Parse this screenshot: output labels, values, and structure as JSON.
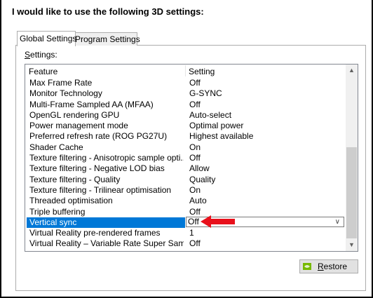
{
  "dialog": {
    "heading": "I would like to use the following 3D settings:"
  },
  "tabs": [
    {
      "label": "Global Settings",
      "active": true
    },
    {
      "label": "Program Settings",
      "active": false
    }
  ],
  "settings_label": "Settings:",
  "settings_label_parts": {
    "underlined": "S",
    "rest": "ettings:"
  },
  "table": {
    "columns": [
      "Feature",
      "Setting"
    ],
    "rows": [
      {
        "feature": "Max Frame Rate",
        "setting": "Off"
      },
      {
        "feature": "Monitor Technology",
        "setting": "G-SYNC"
      },
      {
        "feature": "Multi-Frame Sampled AA (MFAA)",
        "setting": "Off"
      },
      {
        "feature": "OpenGL rendering GPU",
        "setting": "Auto-select"
      },
      {
        "feature": "Power management mode",
        "setting": "Optimal power"
      },
      {
        "feature": "Preferred refresh rate (ROG PG27U)",
        "setting": "Highest available"
      },
      {
        "feature": "Shader Cache",
        "setting": "On"
      },
      {
        "feature": "Texture filtering - Anisotropic sample opti...",
        "setting": "Off"
      },
      {
        "feature": "Texture filtering - Negative LOD bias",
        "setting": "Allow"
      },
      {
        "feature": "Texture filtering - Quality",
        "setting": "Quality"
      },
      {
        "feature": "Texture filtering - Trilinear optimisation",
        "setting": "On"
      },
      {
        "feature": "Threaded optimisation",
        "setting": "Auto"
      },
      {
        "feature": "Triple buffering",
        "setting": "Off"
      },
      {
        "feature": "Vertical sync",
        "setting": "Off",
        "selected": true
      },
      {
        "feature": "Virtual Reality pre-rendered frames",
        "setting": "1"
      },
      {
        "feature": "Virtual Reality – Variable Rate Super Sampli...",
        "setting": "Off"
      }
    ]
  },
  "restore_button": {
    "label_underlined": "R",
    "label_rest": "estore"
  },
  "colors": {
    "selection": "#0078d7",
    "annotation_arrow": "#e8101b",
    "nvidia_green": "#76b900"
  },
  "icons": {
    "scroll_up": "chevron-up-icon",
    "scroll_down": "chevron-down-icon",
    "dropdown": "chevron-down-icon",
    "restore": "nvidia-logo-icon",
    "annotation": "red-arrow-icon"
  }
}
